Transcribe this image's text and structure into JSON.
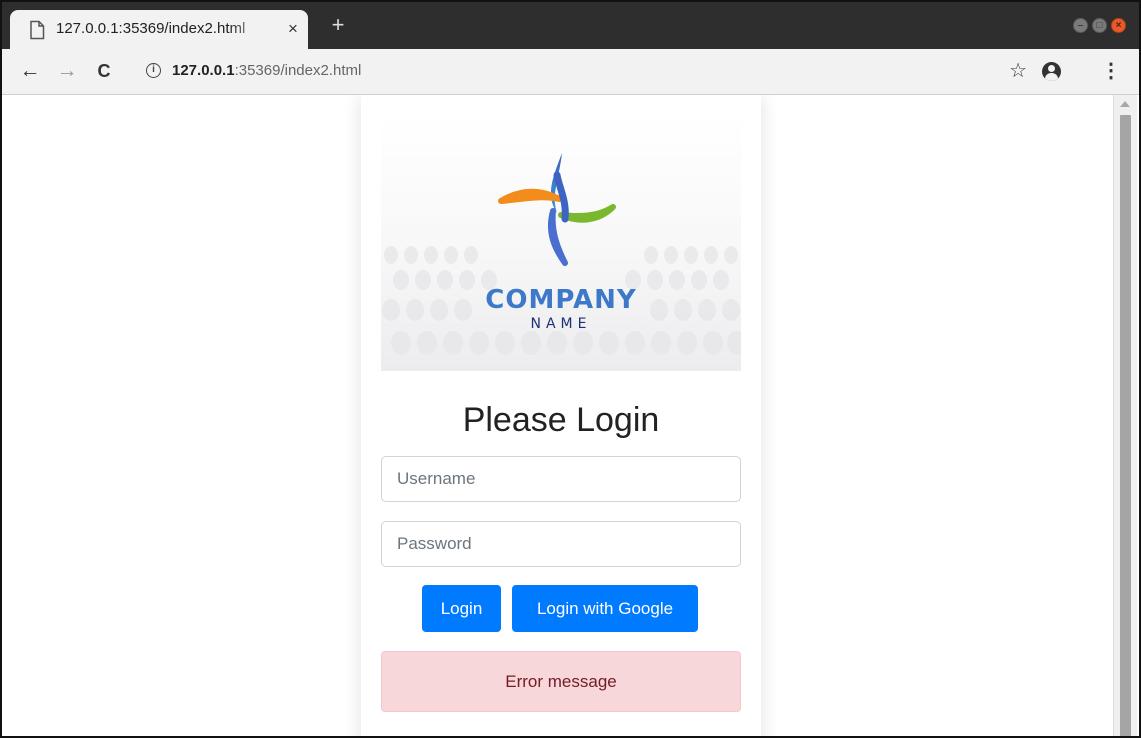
{
  "browser": {
    "tab_title": "127.0.0.1:35369/index2.html",
    "tab_close": "×",
    "new_tab": "+",
    "url_host": "127.0.0.1",
    "url_rest": ":35369/index2.html"
  },
  "icons": {
    "back": "arrow-left-icon",
    "forward": "arrow-right-icon",
    "reload": "reload-icon",
    "info": "info-icon",
    "bookmark": "star-icon",
    "account": "account-icon",
    "menu": "kebab-menu-icon"
  },
  "logo": {
    "line1": "COMPANY",
    "line2": "NAME"
  },
  "login": {
    "heading": "Please Login",
    "username_placeholder": "Username",
    "password_placeholder": "Password",
    "login_button": "Login",
    "google_button": "Login with Google",
    "error_message": "Error message"
  },
  "colors": {
    "primary_button": "#007bff",
    "alert_background": "#f8d7da",
    "alert_text": "#721c24",
    "window_close": "#e65a2c"
  }
}
